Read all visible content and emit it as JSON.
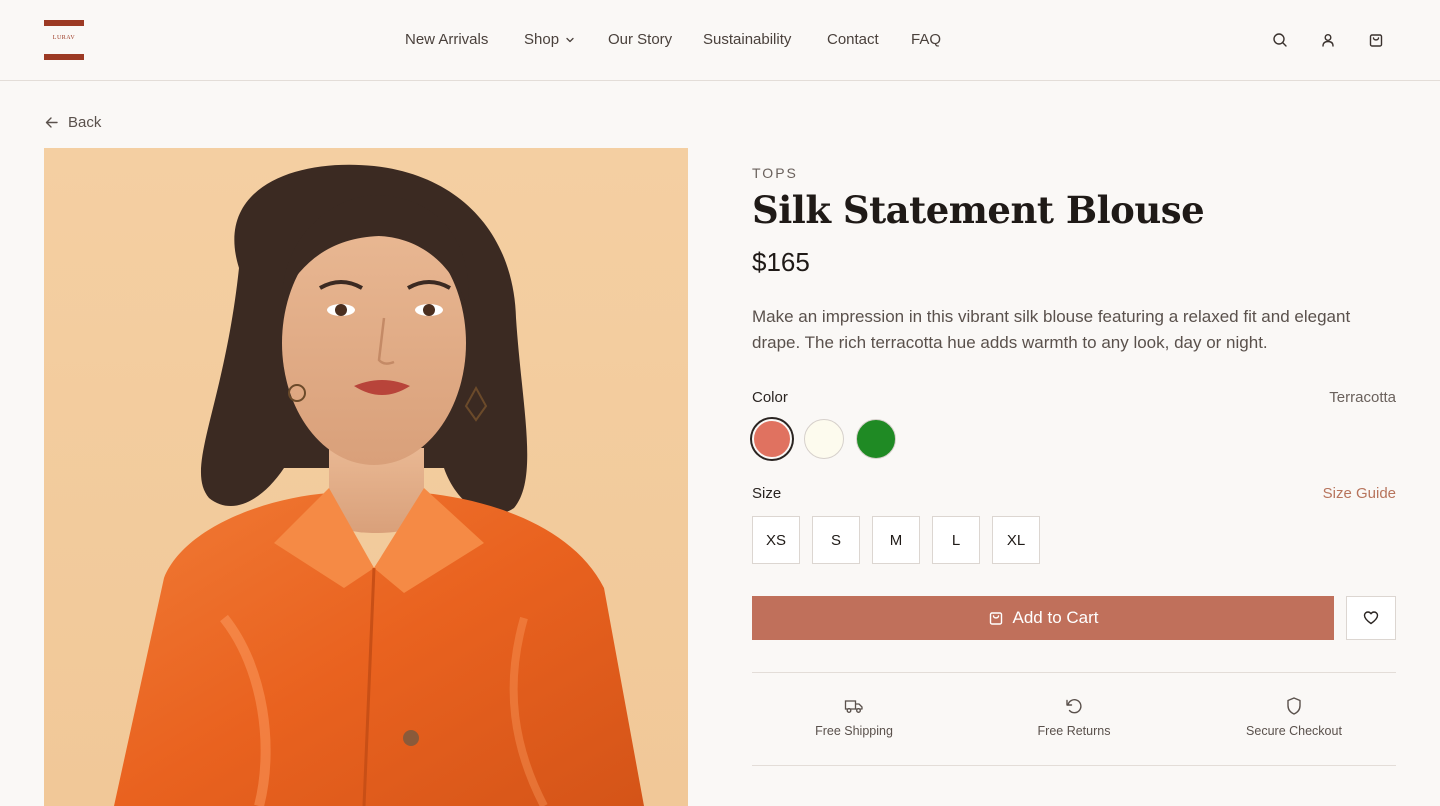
{
  "brand": {
    "logo_text": "LURAV",
    "accent": "#9c3a24"
  },
  "nav": {
    "items": [
      {
        "label": "New Arrivals"
      },
      {
        "label": "Shop"
      },
      {
        "label": "Our Story"
      },
      {
        "label": "Sustainability"
      },
      {
        "label": "Contact"
      },
      {
        "label": "FAQ"
      }
    ]
  },
  "header_icons": [
    "search-icon",
    "user-icon",
    "shopping-bag-icon"
  ],
  "back_label": "Back",
  "product": {
    "category": "TOPS",
    "title": "Silk Statement Blouse",
    "price": "$165",
    "description": "Make an impression in this vibrant silk blouse featuring a relaxed fit and elegant drape. The rich terracotta hue adds warmth to any look, day or night.",
    "color_label": "Color",
    "selected_color": "Terracotta",
    "colors": [
      "#e07260",
      "#fdfbee",
      "#1f8a24"
    ],
    "size_label": "Size",
    "size_guide_label": "Size Guide",
    "sizes": [
      "XS",
      "S",
      "M",
      "L",
      "XL"
    ],
    "add_to_cart_label": "Add to Cart",
    "button_color": "#c0705b"
  },
  "features": [
    {
      "label": "Free Shipping",
      "icon": "truck-icon"
    },
    {
      "label": "Free Returns",
      "icon": "rotate-ccw-icon"
    },
    {
      "label": "Secure Checkout",
      "icon": "shield-icon"
    }
  ]
}
